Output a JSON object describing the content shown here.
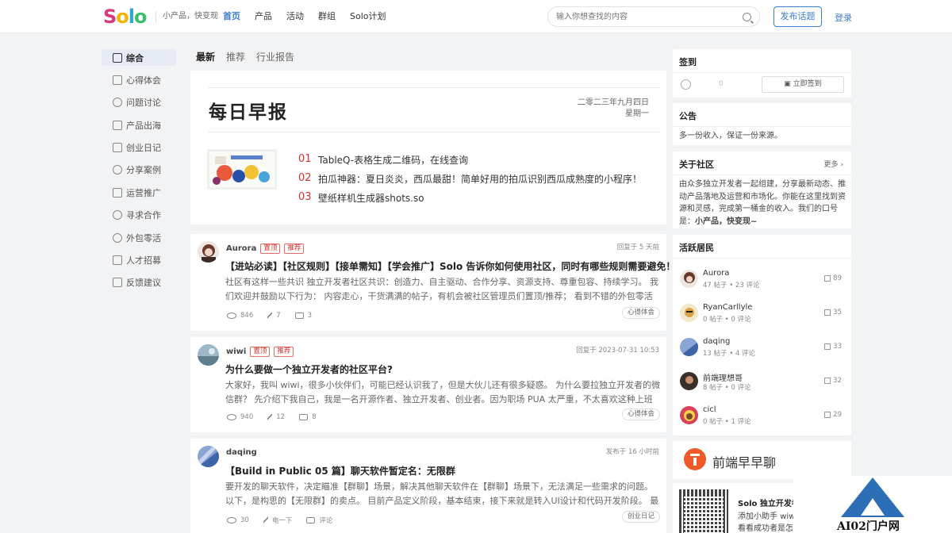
{
  "header": {
    "logo": [
      "S",
      "o",
      "l",
      "o"
    ],
    "logo_colors": [
      "#d83a7e",
      "#f4b400",
      "#2fa7d6",
      "#3cbf6d"
    ],
    "slogan": "小产品，快变现",
    "nav": [
      "首页",
      "产品",
      "活动",
      "群组",
      "Solo计划"
    ],
    "search_placeholder": "输入你想查找的内容",
    "post_button": "发布话题",
    "login": "登录"
  },
  "sidebar": {
    "items": [
      "综合",
      "心得体会",
      "问题讨论",
      "产品出海",
      "创业日记",
      "分享案例",
      "运营推广",
      "寻求合作",
      "外包零活",
      "人才招募",
      "反馈建议"
    ]
  },
  "tabs": [
    "最新",
    "推荐",
    "行业报告"
  ],
  "daily": {
    "title": "每日早报",
    "date": "二零二三年九月四日",
    "weekday": "星期一",
    "items": [
      {
        "num": "01",
        "text": "TableQ-表格生成二维码，在线查询"
      },
      {
        "num": "02",
        "text": "拍瓜神器：夏日炎炎，西瓜最甜！简单好用的拍瓜识别西瓜成熟度的小程序！"
      },
      {
        "num": "03",
        "text": "壁纸样机生成器shots.so"
      }
    ]
  },
  "posts": [
    {
      "author": "Aurora",
      "tags": [
        "置顶",
        "推荐"
      ],
      "meta": "回复于 5 天前",
      "title": "【进站必读】【社区规则】【接单需知】【学会推广】Solo 告诉你如何使用社区，同时有哪些规则需要避免！",
      "excerpt": "社区有这样一些共识 独立开发者社区共识：创造力、自主驱动、合作分享、资源支持、尊重包容、持续学习。 我们欢迎并鼓励以下行为： 内容走心，干货满满的帖子，有机会被社区管理员们置顶/推荐； 看到不错的外包零活和资源…",
      "views": "846",
      "likes": "7",
      "comments": "3",
      "category": "心得体会"
    },
    {
      "author": "wiwi",
      "tags": [
        "置顶",
        "推荐"
      ],
      "meta": "回复于 2023-07-31 10:53",
      "title": "为什么要做一个独立开发者的社区平台?",
      "excerpt": "大家好，我叫 wiwi，很多小伙伴们，可能已经认识我了，但是大伙儿还有很多疑惑。 为什么要拉独立开发者的微信群？ 先介绍下我自己，我是一名开源作者、独立开发者、创业者。因为职场 PUA 太严重，不太喜欢这种上班环境，…",
      "views": "940",
      "likes": "12",
      "comments": "8",
      "category": "心得体会"
    },
    {
      "author": "daqing",
      "tags": [],
      "meta": "发布于 16 小时前",
      "title": "【Build in Public 05 篇】聊天软件暂定名：无限群",
      "excerpt": "要开发的聊天软件，决定瞄准【群聊】场景，解决其他聊天软件在【群聊】场景下，无法满足一些需求的问题。 以下，是构思的【无限群】的卖点。 目前产品定义阶段，基本结束，接下来就是转入UI设计和代码开发阶段。 最近工…",
      "views": "30",
      "likes": "电一下",
      "comments": "评论",
      "category": "创业日记"
    }
  ],
  "right": {
    "checkin": {
      "title": "签到",
      "value": "0",
      "button": "立即签到"
    },
    "notice": {
      "title": "公告",
      "text": "多一份收入，保证一份来源。"
    },
    "about": {
      "title": "关于社区",
      "more": "更多",
      "text": "由众多独立开发者一起组建，分享最新动态、推动产品落地及运营和市场化。你能在这里找到资源和灵感，完成第一桶金的收入。我们的口号是：",
      "slogan": "小产品，快变现~"
    },
    "residents": {
      "title": "活跃居民",
      "list": [
        {
          "name": "Aurora",
          "stat": "47 帖子 • 23 评论",
          "count": "89",
          "color": "#8c5e4b"
        },
        {
          "name": "RyanCarllyle",
          "stat": "0 帖子 • 0 评论",
          "count": "35",
          "color": "#d9a24a"
        },
        {
          "name": "daqing",
          "stat": "13 帖子 • 4 评论",
          "count": "33",
          "color": "#5b7fbf"
        },
        {
          "name": "前端理想哥",
          "stat": "8 帖子 • 0 评论",
          "count": "32",
          "color": "#3a2e2a"
        },
        {
          "name": "cicl",
          "stat": "0 帖子 • 1 评论",
          "count": "29",
          "color": "#d8405a"
        }
      ]
    },
    "zbl": "前端早早聊",
    "qr": {
      "line1": "Solo 独立开发者",
      "line2": "添加小助手 wiwi",
      "line3": "看看成功者是怎么"
    }
  },
  "watermark": "AI02门户网"
}
